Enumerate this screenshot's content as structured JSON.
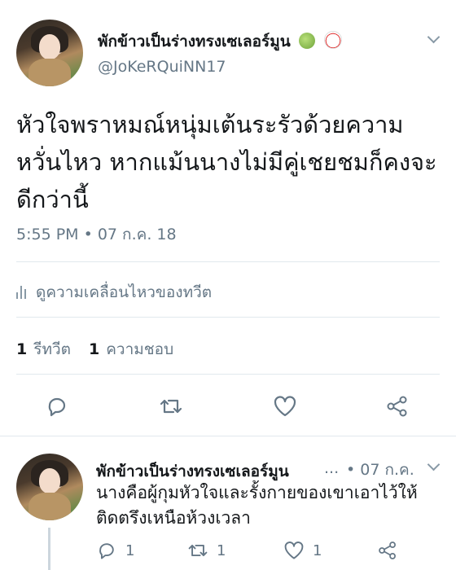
{
  "main_tweet": {
    "display_name": "พักข้าวเป็นร่างทรงเซเลอร์มูน",
    "handle": "@JoKeRQuiNN17",
    "text": "หัวใจพราหมณ์หนุ่มเต้นระรัวด้วยความหวั่นไหว หากแม้นนางไม่มีคู่เชยชมก็คงจะดีกว่านี้",
    "timestamp": "5:55 PM • 07 ก.ค. 18",
    "activity_label": "ดูความเคลื่อนไหวของทวีต",
    "retweet_count": "1",
    "retweet_label": "รีทวีต",
    "like_count": "1",
    "like_label": "ความชอบ"
  },
  "reply_tweet": {
    "display_name": "พักข้าวเป็นร่างทรงเซเลอร์มูน",
    "ellipsis": "...",
    "timestamp": "• 07 ก.ค.",
    "text": "นางคือผู้กุมหัวใจและรั้งกายของเขาเอาไว้ให้ติดตรึงเหนือห้วงเวลา",
    "reply_count": "1",
    "retweet_count": "1",
    "like_count": "1"
  },
  "colors": {
    "text": "#14171a",
    "secondary": "#657786",
    "divider": "#e1e8ed",
    "icon": "#657786"
  },
  "icons": [
    "melon-emoji-icon",
    "bubble-tea-emoji-icon",
    "chevron-down-icon",
    "reply-icon",
    "retweet-icon",
    "heart-icon",
    "share-icon",
    "activity-bars-icon"
  ]
}
